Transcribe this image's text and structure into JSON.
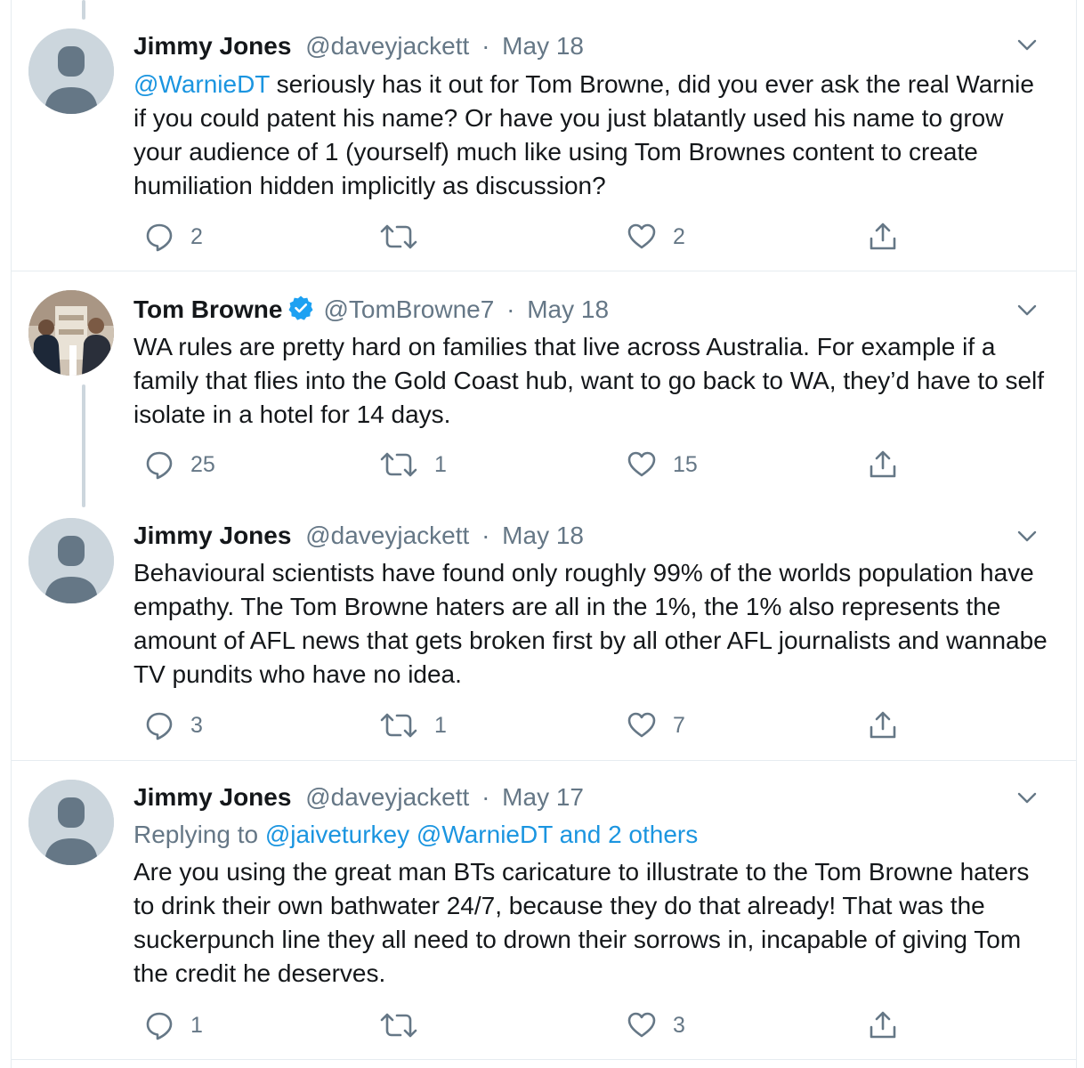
{
  "tweets": [
    {
      "name": "Jimmy Jones",
      "handle": "@daveyjackett",
      "dot": "·",
      "date": "May 18",
      "mention": "@WarnieDT",
      "text": " seriously has it out for Tom Browne, did you ever ask the real Warnie if you could patent his name? Or have you just blatantly used his name to grow your audience of 1 (yourself) much like using Tom Brownes content to create humiliation hidden implicitly as discussion?",
      "replies": "2",
      "retweets": "",
      "likes": "2"
    },
    {
      "name": "Tom Browne",
      "handle": "@TomBrowne7",
      "dot": "·",
      "date": "May 18",
      "text": "WA rules are pretty hard on families that live across Australia. For example if a family that flies into the Gold Coast hub, want to go back to WA, they’d have to self isolate in a hotel for 14 days.",
      "replies": "25",
      "retweets": "1",
      "likes": "15"
    },
    {
      "name": "Jimmy Jones",
      "handle": "@daveyjackett",
      "dot": "·",
      "date": "May 18",
      "text": "Behavioural scientists have found only roughly 99% of the worlds population have empathy. The Tom Browne haters are all in the 1%, the 1% also represents the amount of AFL news that gets broken first by all other AFL journalists and wannabe TV pundits who have no idea.",
      "replies": "3",
      "retweets": "1",
      "likes": "7"
    },
    {
      "name": "Jimmy Jones",
      "handle": "@daveyjackett",
      "dot": "·",
      "date": "May 17",
      "replying_prefix": "Replying to ",
      "replying_to": "@jaiveturkey @WarnieDT and 2 others",
      "text": "Are you using the great man BTs caricature to illustrate to the Tom Browne haters to drink their own bathwater 24/7, because they do that already! That was the suckerpunch line they all need to drown their sorrows in, incapable of giving Tom the credit he deserves.",
      "replies": "1",
      "retweets": "",
      "likes": "3"
    }
  ],
  "icons": {
    "reply": "speech-bubble-icon",
    "retweet": "retweet-arrows-icon",
    "like": "heart-icon",
    "share": "share-upload-icon",
    "more": "chevron-down-icon",
    "verified": "verified-badge-icon"
  },
  "colors": {
    "link": "#1b95e0",
    "secondary": "#657786",
    "border": "#e6ecf0",
    "verified": "#1da1f2"
  }
}
